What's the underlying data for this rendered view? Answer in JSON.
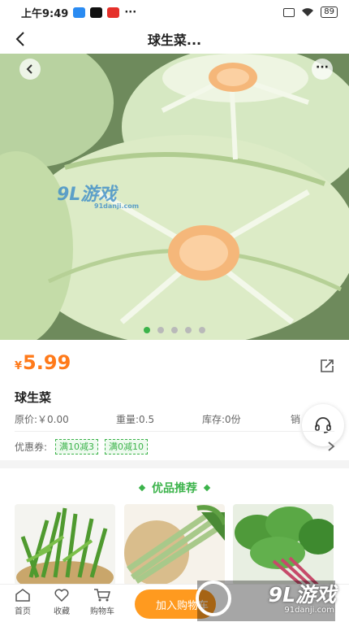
{
  "status_bar": {
    "time": "上午9:49",
    "dots": "···",
    "battery": "89"
  },
  "nav": {
    "title": "球生菜..."
  },
  "hero": {
    "more_label": "···",
    "slide_count": 5,
    "active_slide": 1,
    "watermark": {
      "text": "9L游戏",
      "url": "91danji.com"
    }
  },
  "product": {
    "price_symbol": "¥",
    "price": "5.99",
    "name": "球生菜",
    "original_price": "原价:￥0.00",
    "weight": "重量:0.5",
    "stock": "库存:0份",
    "sales": "销"
  },
  "coupons": {
    "label": "优惠券:",
    "items": [
      "满10减3",
      "满0减10"
    ]
  },
  "recommend": {
    "title": "优品推荐",
    "items": [
      {
        "icon": "dandelion-greens-image"
      },
      {
        "icon": "asparagus-lettuce-image"
      },
      {
        "icon": "spinach-image"
      }
    ]
  },
  "tabbar": {
    "home": "首页",
    "favorite": "收藏",
    "cart": "购物车",
    "add_to_cart": "加入购物车"
  },
  "watermark_bottom": {
    "text": "9L游戏",
    "url": "91danji.com"
  },
  "colors": {
    "accent_green": "#3bb34a",
    "price_orange": "#ff7a1a",
    "cart_orange": "#ff9a1f"
  }
}
